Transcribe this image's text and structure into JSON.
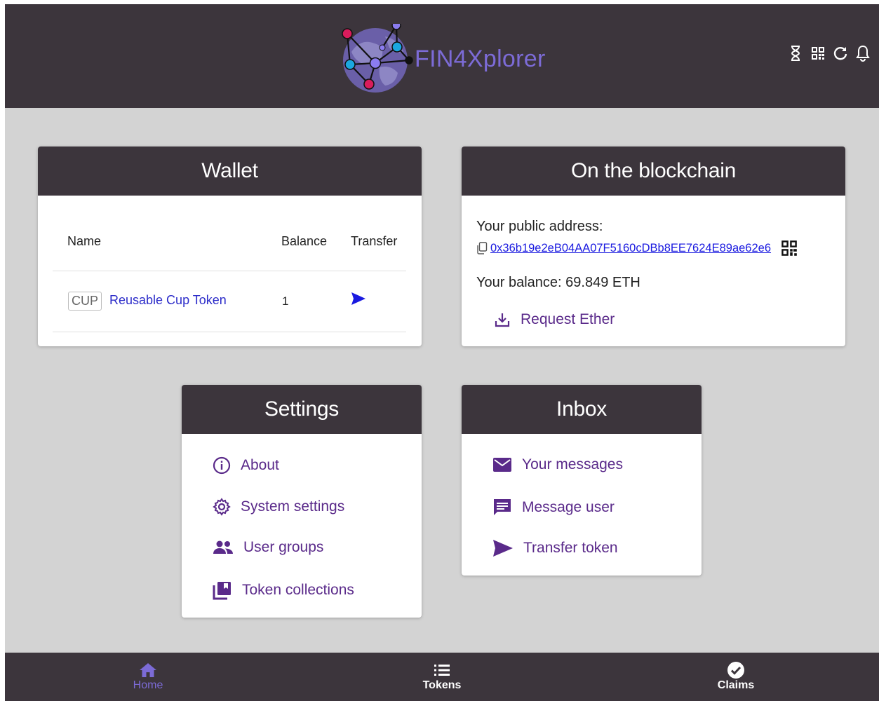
{
  "header": {
    "app_name": "FIN4Xplorer",
    "icons": [
      "hourglass-icon",
      "qr-code-icon",
      "refresh-icon",
      "bell-icon"
    ]
  },
  "wallet": {
    "title": "Wallet",
    "columns": [
      "Name",
      "Balance",
      "Transfer"
    ],
    "tokens": [
      {
        "symbol": "CUP",
        "name": "Reusable Cup Token",
        "balance": "1"
      }
    ]
  },
  "blockchain": {
    "title": "On the blockchain",
    "address_label": "Your public address:",
    "address": "0x36b19e2eB04AA07F5160cDBb8EE7624E89ae62e6",
    "balance_text": "Your balance: 69.849 ETH",
    "request_ether_label": "Request Ether"
  },
  "settings": {
    "title": "Settings",
    "items": [
      {
        "label": "About",
        "icon": "info-icon"
      },
      {
        "label": "System settings",
        "icon": "gear-icon"
      },
      {
        "label": "User groups",
        "icon": "people-icon"
      },
      {
        "label": "Token collections",
        "icon": "collections-icon"
      }
    ]
  },
  "inbox": {
    "title": "Inbox",
    "items": [
      {
        "label": "Your messages",
        "icon": "envelope-icon"
      },
      {
        "label": "Message user",
        "icon": "chat-icon"
      },
      {
        "label": "Transfer token",
        "icon": "send-icon"
      }
    ]
  },
  "bottom_nav": {
    "items": [
      {
        "label": "Home",
        "icon": "home-icon",
        "active": true
      },
      {
        "label": "Tokens",
        "icon": "list-icon",
        "active": false
      },
      {
        "label": "Claims",
        "icon": "check-circle-icon",
        "active": false
      }
    ]
  },
  "colors": {
    "header_bg": "#3c353c",
    "page_bg": "#d3d3d3",
    "accent_purple": "#5a2a8a",
    "brand_purple": "#7c6bd6",
    "link_blue": "#2c2cc9"
  }
}
